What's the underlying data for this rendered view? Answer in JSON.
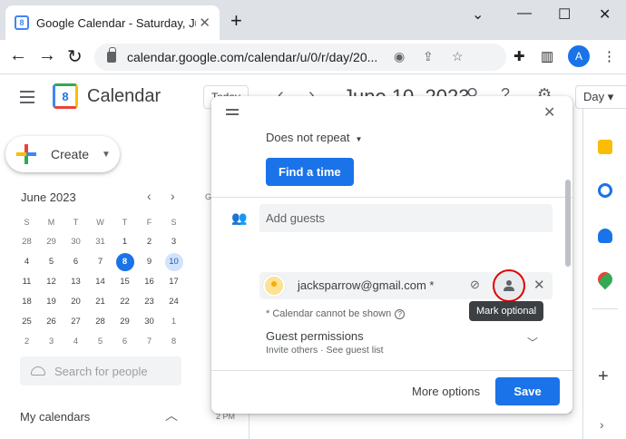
{
  "browser": {
    "tab_title": "Google Calendar - Saturday, June",
    "tab_favicon_text": "8",
    "url": "calendar.google.com/calendar/u/0/r/day/20...",
    "profile_initial": "A",
    "new_tab_symbol": "+",
    "close_tab_symbol": "✕"
  },
  "app": {
    "logo_text": "8",
    "name": "Calendar",
    "today_label": "Today",
    "current_date": "June 10, 2023",
    "view_label": "Day",
    "create_label": "Create"
  },
  "mini_calendar": {
    "title": "June 2023",
    "weekdays": [
      "S",
      "M",
      "T",
      "W",
      "T",
      "F",
      "S"
    ],
    "weeks": [
      [
        "28",
        "29",
        "30",
        "31",
        "1",
        "2",
        "3"
      ],
      [
        "4",
        "5",
        "6",
        "7",
        "8",
        "9",
        "10"
      ],
      [
        "11",
        "12",
        "13",
        "14",
        "15",
        "16",
        "17"
      ],
      [
        "18",
        "19",
        "20",
        "21",
        "22",
        "23",
        "24"
      ],
      [
        "25",
        "26",
        "27",
        "28",
        "29",
        "30",
        "1"
      ],
      [
        "2",
        "3",
        "4",
        "5",
        "6",
        "7",
        "8"
      ]
    ],
    "selected_day": "8",
    "highlighted_day": "10"
  },
  "sidebar": {
    "search_people_placeholder": "Search for people",
    "my_calendars_label": "My calendars"
  },
  "grid": {
    "column_letter": "G",
    "time_label": "2 PM"
  },
  "dialog": {
    "repeat_label": "Does not repeat",
    "find_time_label": "Find a time",
    "add_guests_placeholder": "Add guests",
    "guest_email": "jacksparrow@gmail.com *",
    "tooltip": "Mark optional",
    "calendar_note": "* Calendar cannot be shown",
    "permissions_title": "Guest permissions",
    "permissions_subtitle": "Invite others · See guest list",
    "more_options_label": "More options",
    "save_label": "Save"
  },
  "colors": {
    "accent": "#1a73e8",
    "highlight_circle": "#e00000",
    "tooltip_bg": "#3c4043"
  }
}
